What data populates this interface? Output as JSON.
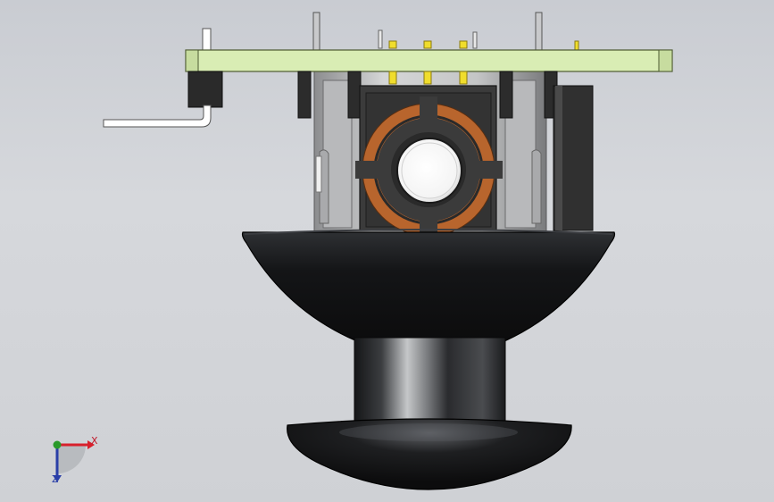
{
  "viewport": {
    "model": "joystick-assembly",
    "background_top": "#c9ccd2",
    "background_bottom": "#cfd1d5"
  },
  "triad": {
    "x_label": "X",
    "z_label": "Z",
    "x_color": "#d8202c",
    "y_color": "#2a9a2a",
    "z_color": "#2a3fa8"
  },
  "colors": {
    "pcb": "#d9edb4",
    "copper": "#b8652d",
    "rubber": "#141517",
    "housing": "#3b3b3b",
    "pin": "#f0dd2c"
  }
}
